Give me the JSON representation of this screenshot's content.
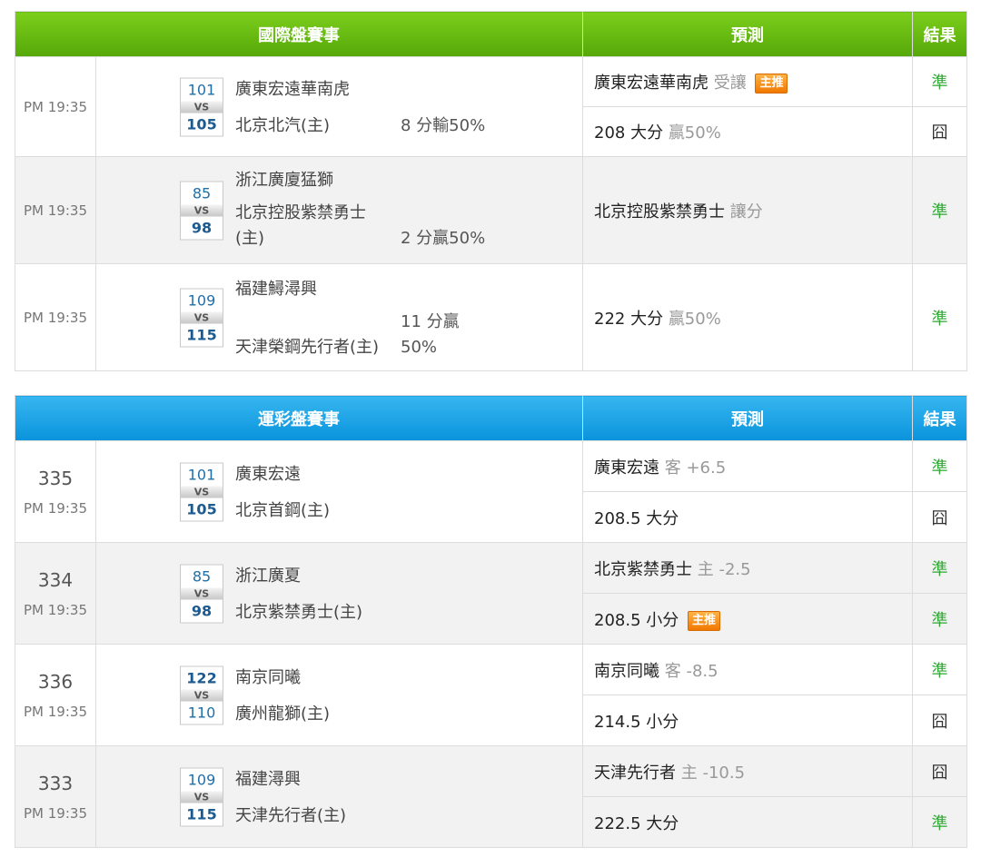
{
  "intl": {
    "header": {
      "match": "國際盤賽事",
      "predict": "預測",
      "result": "結果"
    },
    "games": [
      {
        "time": "PM 19:35",
        "away": {
          "score": "101",
          "name": "廣東宏遠華南虎"
        },
        "vs": "VS",
        "home": {
          "score": "105",
          "name": "北京北汽(主)"
        },
        "spread": "8 分輸50%",
        "predictions": [
          {
            "main": "廣東宏遠華南虎",
            "extra": "受讓",
            "badge": "主推",
            "result": "準"
          },
          {
            "main": "208 大分",
            "extra": "贏50%",
            "result": "囧"
          }
        ]
      },
      {
        "time": "PM 19:35",
        "away": {
          "score": "85",
          "name": "浙江廣廈猛獅"
        },
        "vs": "VS",
        "home": {
          "score": "98",
          "name_l1": "北京控股紫禁勇士",
          "name_l2": "(主)"
        },
        "spread": "2 分贏50%",
        "predictions": [
          {
            "main": "北京控股紫禁勇士",
            "extra": "讓分",
            "result": "準"
          }
        ]
      },
      {
        "time": "PM 19:35",
        "away": {
          "score": "109",
          "name": "福建鱘潯興"
        },
        "vs": "VS",
        "home": {
          "score": "115",
          "name": "天津榮鋼先行者(主)"
        },
        "spread_l1": "11 分贏",
        "spread_l2": "50%",
        "predictions": [
          {
            "main": "222 大分",
            "extra": "贏50%",
            "result": "準"
          }
        ]
      }
    ]
  },
  "lottery": {
    "header": {
      "match": "運彩盤賽事",
      "predict": "預測",
      "result": "結果"
    },
    "games": [
      {
        "code": "335",
        "time": "PM 19:35",
        "away": {
          "score": "101",
          "name": "廣東宏遠"
        },
        "vs": "VS",
        "home": {
          "score": "105",
          "name": "北京首鋼(主)"
        },
        "predictions": [
          {
            "main": "廣東宏遠",
            "extra": "客 +6.5",
            "result": "準"
          },
          {
            "main": "208.5 大分",
            "result": "囧"
          }
        ]
      },
      {
        "code": "334",
        "time": "PM 19:35",
        "away": {
          "score": "85",
          "name": "浙江廣夏"
        },
        "vs": "VS",
        "home": {
          "score": "98",
          "name": "北京紫禁勇士(主)"
        },
        "predictions": [
          {
            "main": "北京紫禁勇士",
            "extra": "主 -2.5",
            "result": "準"
          },
          {
            "main": "208.5 小分",
            "badge": "主推",
            "result": "準"
          }
        ]
      },
      {
        "code": "336",
        "time": "PM 19:35",
        "away": {
          "score": "122",
          "name": "南京同曦"
        },
        "vs": "VS",
        "home": {
          "score": "110",
          "name": "廣州龍獅(主)"
        },
        "predictions": [
          {
            "main": "南京同曦",
            "extra": "客 -8.5",
            "result": "準"
          },
          {
            "main": "214.5 小分",
            "result": "囧"
          }
        ]
      },
      {
        "code": "333",
        "time": "PM 19:35",
        "away": {
          "score": "109",
          "name": "福建潯興"
        },
        "vs": "VS",
        "home": {
          "score": "115",
          "name": "天津先行者(主)"
        },
        "predictions": [
          {
            "main": "天津先行者",
            "extra": "主 -10.5",
            "result": "囧"
          },
          {
            "main": "222.5 大分",
            "result": "準"
          }
        ]
      }
    ]
  }
}
